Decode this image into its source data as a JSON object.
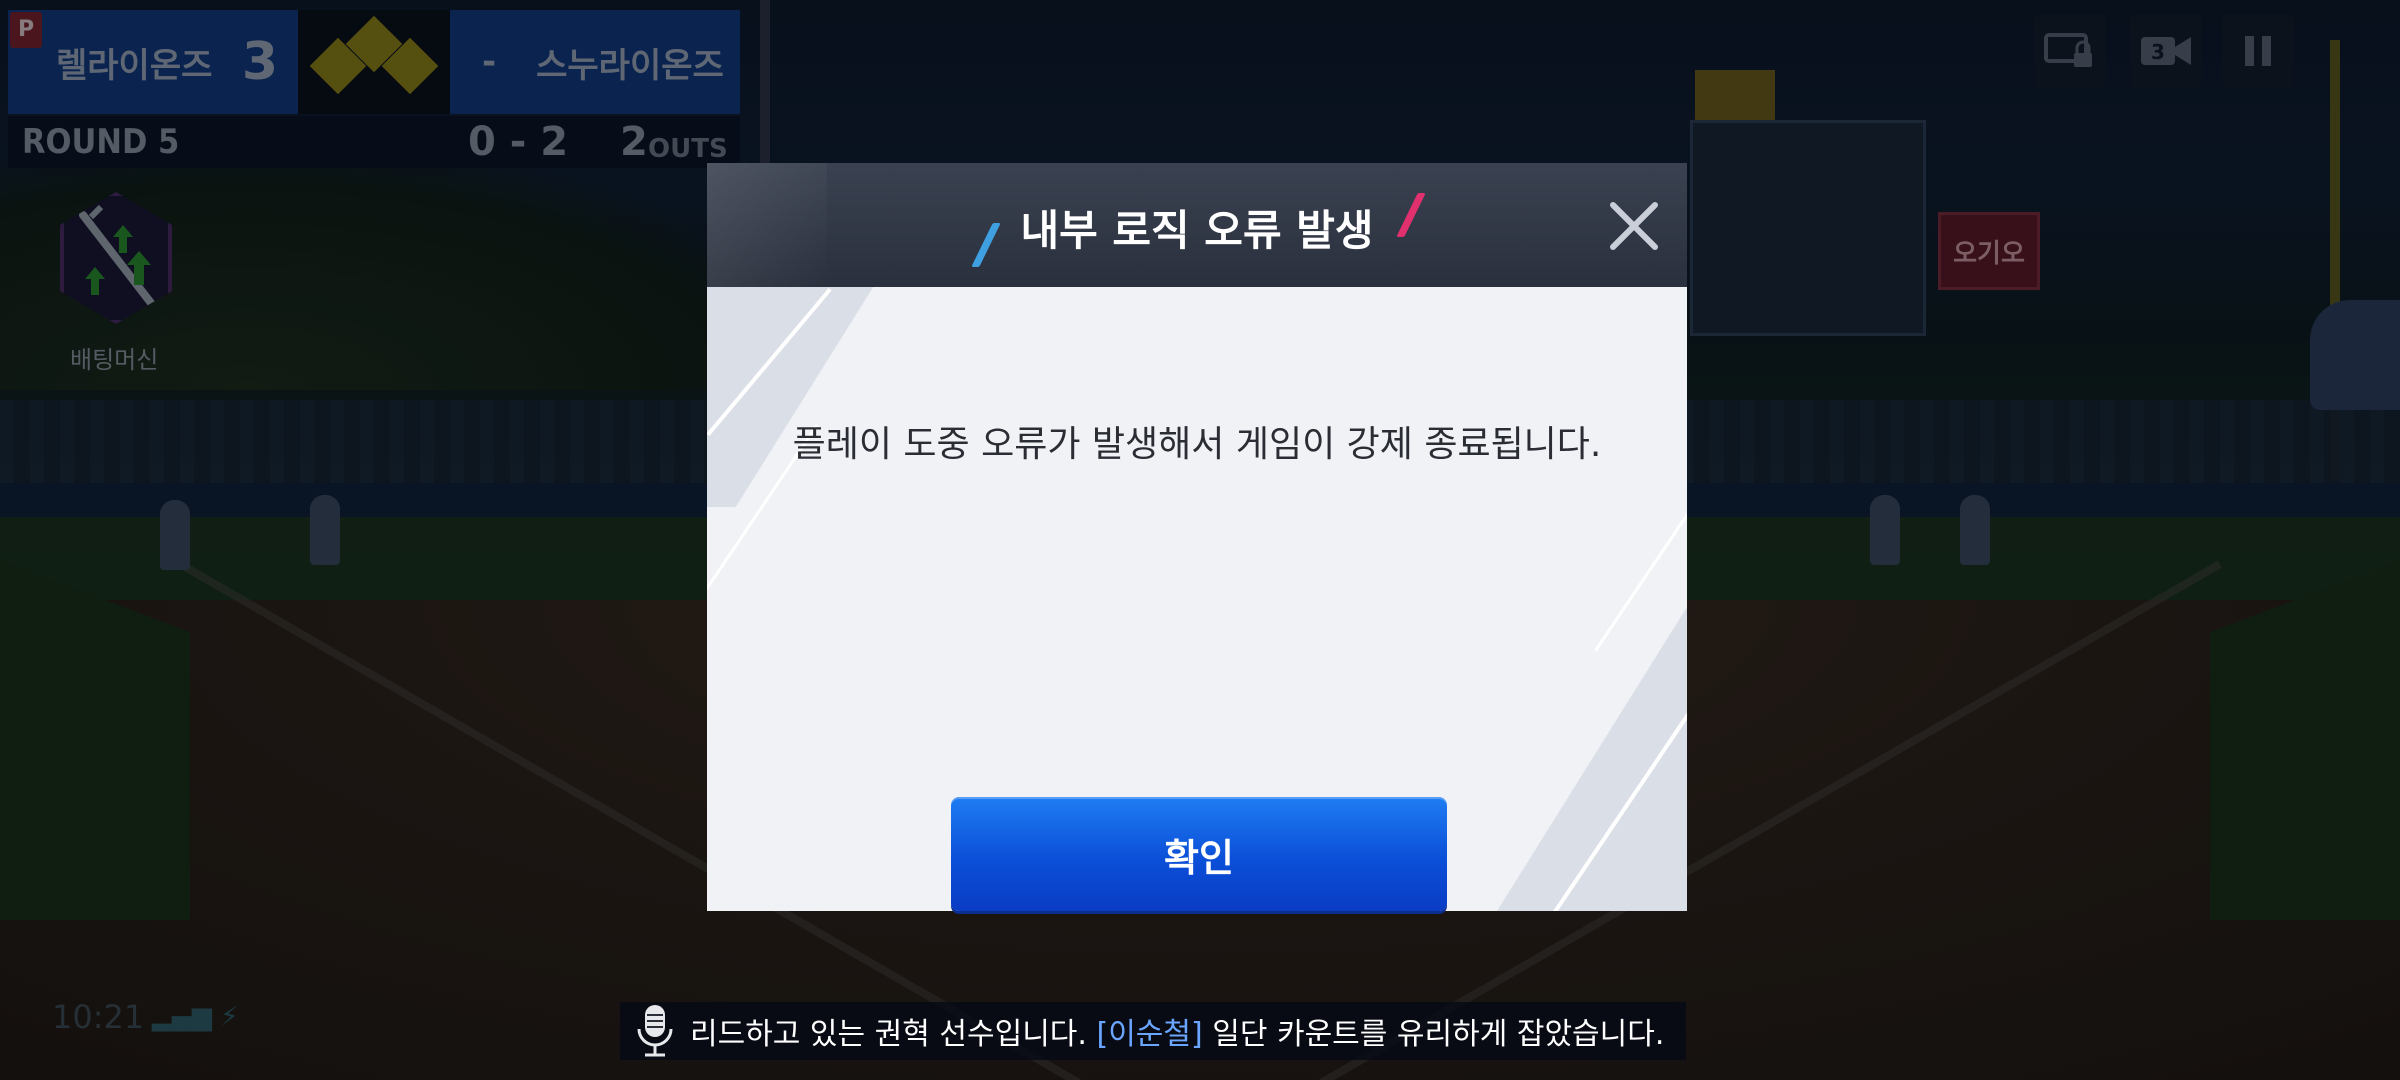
{
  "scoreboard": {
    "team_home": "렐라이온즈",
    "score_home": "3",
    "separator": "-",
    "team_away": "스누라이온즈",
    "logo_letter": "P",
    "round_label": "ROUND 5",
    "ball_strike": "0 - 2",
    "outs_count": "2",
    "outs_label": "OUTS"
  },
  "batting_machine": {
    "label": "배팅머신"
  },
  "stadium_sign": "오기오",
  "controls": [
    {
      "name": "screen-lock-icon"
    },
    {
      "name": "camera-3-icon",
      "label": "3"
    },
    {
      "name": "pause-icon"
    }
  ],
  "status": {
    "time": "10:21"
  },
  "dialog": {
    "title": "내부 로직 오류 발생",
    "message": "플레이 도중 오류가 발생해서 게임이 강제 종료됩니다.",
    "confirm_label": "확인"
  },
  "commentary": {
    "text_before": "리드하고 있는 권혁 선수입니다. ",
    "highlight": "[이순철]",
    "text_after": " 일단 카운트를 유리하게 잡았습니다."
  },
  "colors": {
    "dialog_header": "#2a303d",
    "dialog_body": "#f0f2f6",
    "confirm_button": "#0b4fd8",
    "accent_blue": "#3ea0e0",
    "accent_pink": "#e0306e",
    "commentary_highlight": "#6aa6ff"
  }
}
